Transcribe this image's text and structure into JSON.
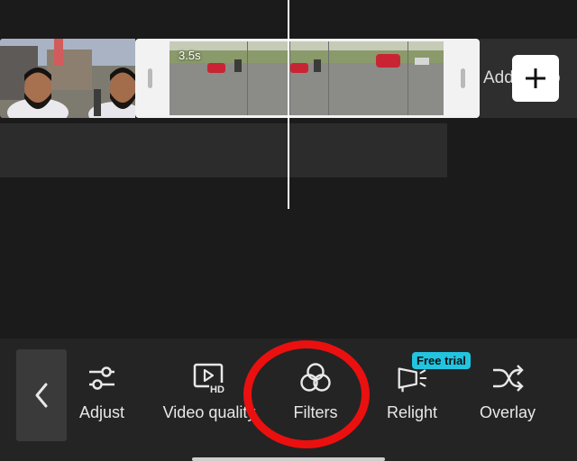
{
  "timeline": {
    "clip_duration": "3.5s",
    "add_audio_label": "Add audio"
  },
  "toolbar": {
    "tools": [
      {
        "label": "Adjust",
        "icon": "sliders-icon"
      },
      {
        "label": "Video quality",
        "icon": "video-hd-icon"
      },
      {
        "label": "Filters",
        "icon": "filters-icon"
      },
      {
        "label": "Relight",
        "icon": "relight-icon",
        "badge": "Free trial"
      },
      {
        "label": "Overlay",
        "icon": "shuffle-icon"
      }
    ]
  },
  "colors": {
    "badge": "#22c4e0",
    "highlight": "#ea1010",
    "background": "#1b1b1b"
  }
}
